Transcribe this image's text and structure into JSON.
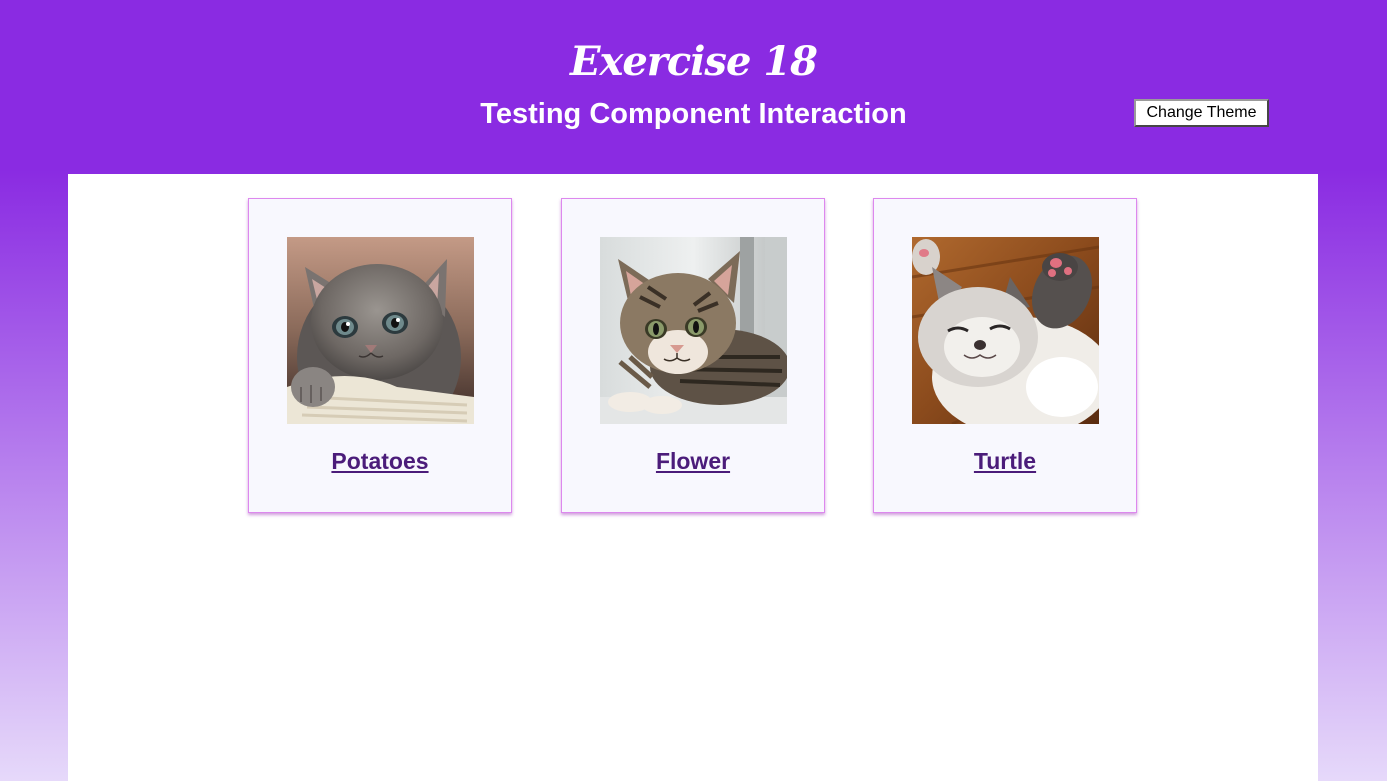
{
  "header": {
    "title": "Exercise 18",
    "subtitle": "Testing Component Interaction",
    "theme_button_label": "Change Theme"
  },
  "cards": [
    {
      "name": "Potatoes",
      "image_alt": "gray fluffy kitten"
    },
    {
      "name": "Flower",
      "image_alt": "tabby kitten lying down"
    },
    {
      "name": "Turtle",
      "image_alt": "sleeping white kitten"
    }
  ],
  "colors": {
    "header_bg": "#8a2be2",
    "gradient_end": "#e6d9fa",
    "card_bg": "#f8f8fe",
    "card_border": "#dd88ee",
    "link": "#4b1c7a"
  }
}
